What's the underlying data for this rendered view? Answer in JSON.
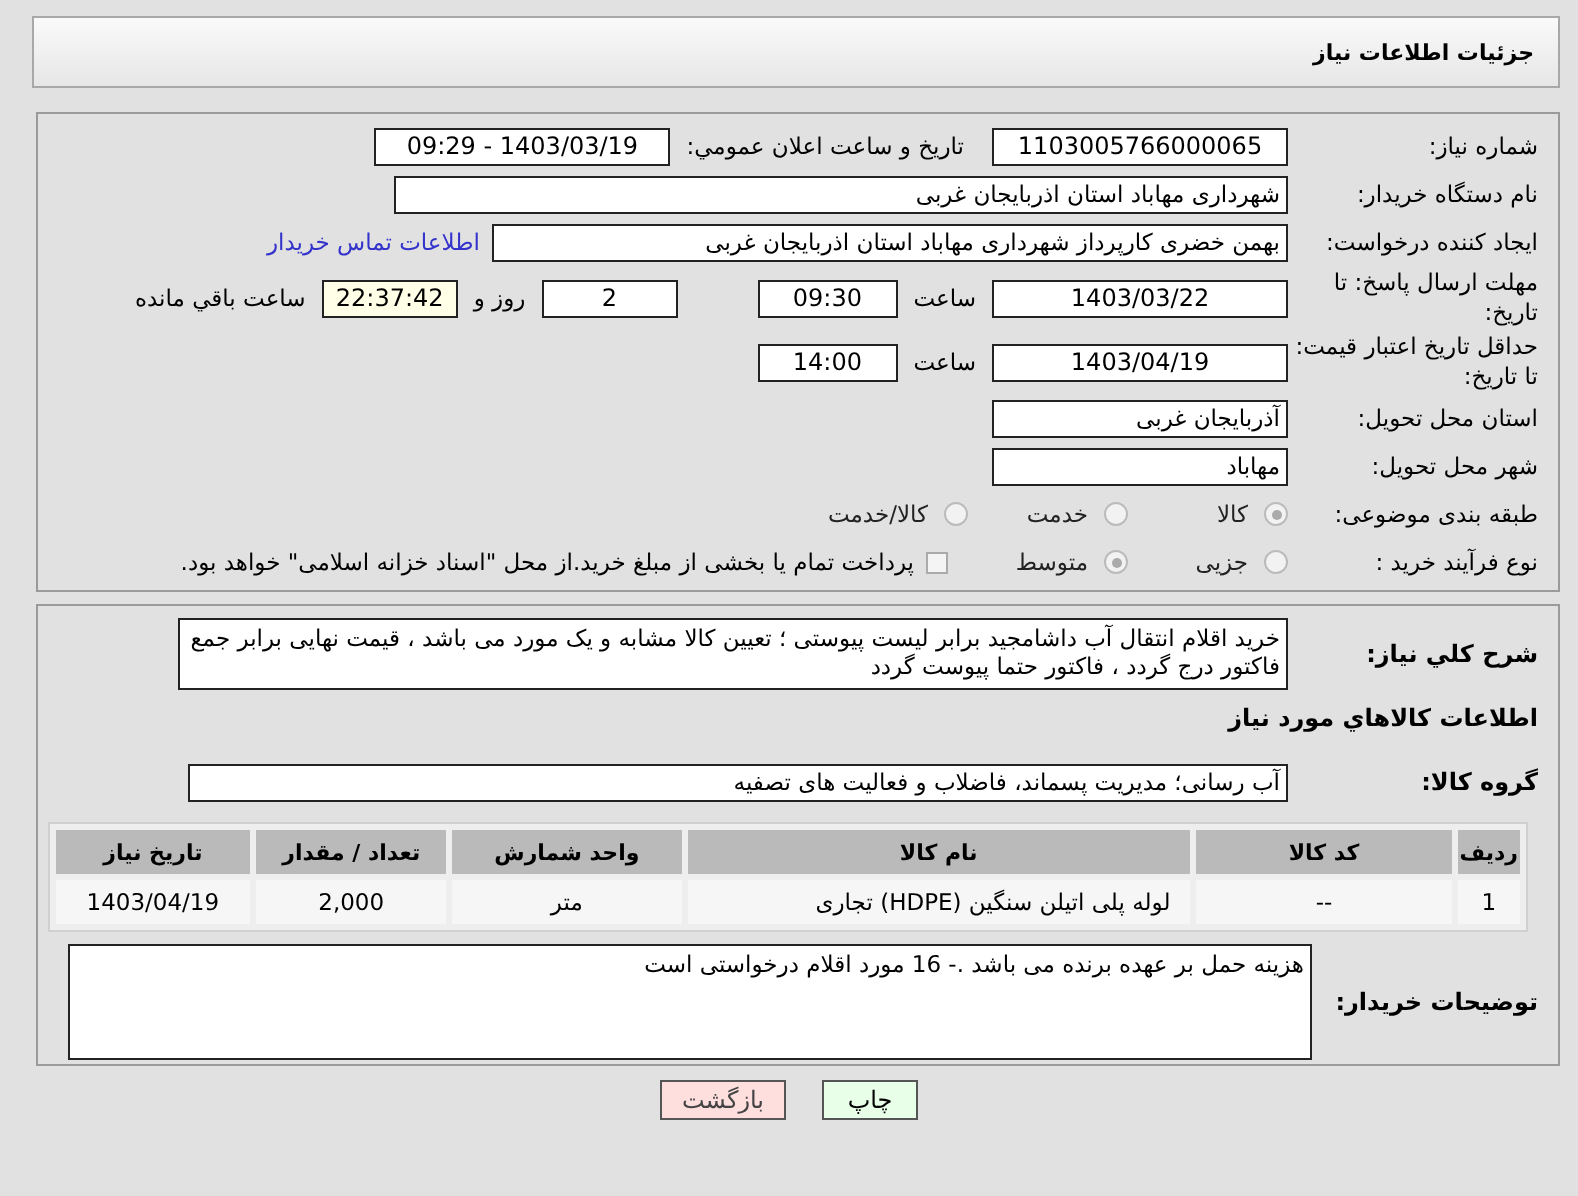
{
  "header": {
    "title": "جزئیات اطلاعات نیاز"
  },
  "need_number": {
    "label": "شماره نیاز:",
    "value": "1103005766000065"
  },
  "announce": {
    "label": "تاریخ و ساعت اعلان عمومي:",
    "value": "1403/03/19 - 09:29"
  },
  "buyer_org": {
    "label": "نام دستگاه خریدار:",
    "value": "شهرداری مهاباد استان اذربایجان غربی"
  },
  "creator": {
    "label": "ایجاد کننده درخواست:",
    "value": "بهمن خضری کارپرداز شهرداری مهاباد استان اذربایجان غربی",
    "link": "اطلاعات تماس خریدار"
  },
  "reply_deadline": {
    "label": "مهلت ارسال پاسخ: تا تاریخ:",
    "date": "1403/03/22",
    "time_label": "ساعت",
    "time": "09:30",
    "days": "2",
    "days_label": "روز و",
    "remaining": "22:37:42",
    "remaining_label": "ساعت باقي مانده"
  },
  "price_validity": {
    "label": "حداقل تاریخ اعتبار قیمت: تا تاریخ:",
    "date": "1403/04/19",
    "time_label": "ساعت",
    "time": "14:00"
  },
  "province": {
    "label": "استان محل تحویل:",
    "value": "آذربایجان غربی"
  },
  "city": {
    "label": "شهر محل تحویل:",
    "value": "مهاباد"
  },
  "category": {
    "label": "طبقه بندی موضوعی:",
    "options": [
      {
        "label": "کالا",
        "selected": true
      },
      {
        "label": "خدمت",
        "selected": false
      },
      {
        "label": "کالا/خدمت",
        "selected": false
      }
    ]
  },
  "process": {
    "label": "نوع فرآیند خرید :",
    "options": [
      {
        "label": "جزیی",
        "selected": false
      },
      {
        "label": "متوسط",
        "selected": true
      }
    ],
    "payment": {
      "label": "پرداخت تمام یا بخشی از مبلغ خرید.از محل \"اسناد خزانه اسلامی\" خواهد بود.",
      "checked": false
    }
  },
  "description": {
    "label": "شرح کلي نیاز:",
    "value": "خرید اقلام انتقال آب داشامجید برابر لیست پیوستی ؛ تعیین کالا مشابه و یک مورد می باشد ، قیمت نهایی برابر جمع فاکتور درج گردد ، فاکتور حتما پیوست گردد"
  },
  "goods_heading": "اطلاعات کالاهاي مورد نیاز",
  "goods_group": {
    "label": "گروه کالا:",
    "value": "آب رسانی؛ مدیریت پسماند، فاضلاب و فعالیت های تصفیه"
  },
  "table": {
    "columns": [
      "ردیف",
      "کد کالا",
      "نام کالا",
      "واحد شمارش",
      "تعداد / مقدار",
      "تاریخ نیاز"
    ],
    "rows": [
      [
        "1",
        "--",
        "لوله پلی اتیلن سنگین (HDPE) تجاری",
        "متر",
        "2,000",
        "1403/04/19"
      ]
    ]
  },
  "buyer_notes": {
    "label": "توضیحات خریدار:",
    "value": "هزینه حمل بر عهده برنده می باشد .- 16 مورد اقلام درخواستی است"
  },
  "buttons": [
    {
      "label": "چاپ",
      "kind": "print"
    },
    {
      "label": "بازگشت",
      "kind": "back"
    }
  ]
}
